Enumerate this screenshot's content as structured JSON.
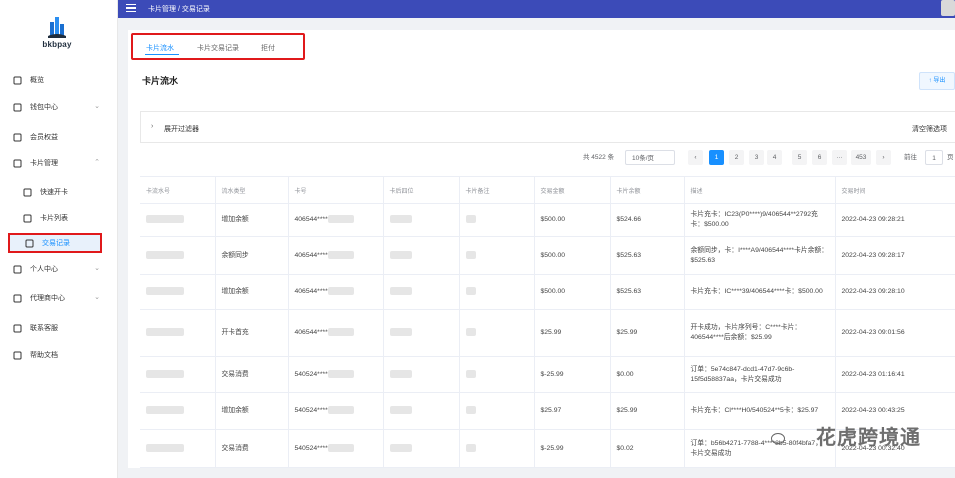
{
  "app": {
    "logo_text": "bkbpay"
  },
  "topbar": {
    "breadcrumb": "卡片管理 / 交易记录"
  },
  "sidebar": {
    "items": [
      {
        "label": "概览",
        "icon": "home-icon"
      },
      {
        "label": "钱包中心",
        "icon": "wallet-icon",
        "arrow": "⌄"
      },
      {
        "label": "会员权益",
        "icon": "member-icon"
      },
      {
        "label": "卡片管理",
        "icon": "card-icon",
        "arrow": "⌃"
      },
      {
        "label": "快速开卡",
        "icon": "file-icon"
      },
      {
        "label": "卡片列表",
        "icon": "list-icon"
      },
      {
        "label": "交易记录",
        "icon": "edit-icon"
      },
      {
        "label": "个人中心",
        "icon": "user-icon",
        "arrow": "⌄"
      },
      {
        "label": "代理商中心",
        "icon": "agent-icon",
        "arrow": "⌄"
      },
      {
        "label": "联系客服",
        "icon": "chat-icon"
      },
      {
        "label": "帮助文档",
        "icon": "doc-icon"
      }
    ]
  },
  "tabs": [
    "卡片流水",
    "卡片交易记录",
    "拒付"
  ],
  "page_title": "卡片流水",
  "export_label": "↑ 导出",
  "filter": {
    "toggle": "展开过滤器",
    "clear": "清空筛选项"
  },
  "pager": {
    "total": "共 4522 条",
    "page_size": "10条/页",
    "pages": [
      "1",
      "2",
      "3",
      "4",
      "5",
      "6",
      "···",
      "453"
    ],
    "goto_label": "前往",
    "goto_value": "1",
    "page_suffix": "页"
  },
  "table": {
    "headers": [
      "卡流水号",
      "流水类型",
      "卡号",
      "卡后四位",
      "卡片备注",
      "交易金额",
      "卡片余额",
      "描述",
      "交易时间"
    ],
    "rows": [
      {
        "type": "增加余额",
        "card": "406544****",
        "amount": "$500.00",
        "balance": "$524.66",
        "desc": "卡片充卡：IC23(P0****)9/406544**2792充卡：$500.00",
        "time": "2022-04-23 09:28:21"
      },
      {
        "type": "余额同步",
        "card": "406544****",
        "amount": "$500.00",
        "balance": "$525.63",
        "desc": "余额同步，卡：I****A9/406544****卡片余额：$525.63",
        "time": "2022-04-23 09:28:17"
      },
      {
        "type": "增加余额",
        "card": "406544****",
        "amount": "$500.00",
        "balance": "$525.63",
        "desc": "卡片充卡：IC****39/406544****卡：$500.00",
        "time": "2022-04-23 09:28:10"
      },
      {
        "type": "开卡首充",
        "card": "406544****",
        "amount": "$25.99",
        "balance": "$25.99",
        "desc": "开卡成功，卡片序列号：C****卡片：406544****后余额：$25.99",
        "time": "2022-04-23 09:01:56"
      },
      {
        "type": "交易消费",
        "card": "540524****",
        "amount": "$-25.99",
        "balance": "$0.00",
        "desc": "订单：5e74c847-dcd1-47d7-9c6b-15f5d58837aa，卡片交易成功",
        "time": "2022-04-23 01:16:41"
      },
      {
        "type": "增加余额",
        "card": "540524****",
        "amount": "$25.97",
        "balance": "$25.99",
        "desc": "卡片充卡：Cl****H0/540524**5卡：$25.97",
        "time": "2022-04-23 00:43:25"
      },
      {
        "type": "交易消费",
        "card": "540524****",
        "amount": "$-25.99",
        "balance": "$0.02",
        "desc": "订单：b56b4271-7788-4****8b5-80f4bfa7，卡片交易成功",
        "time": "2022-04-23 00:32:40"
      }
    ]
  },
  "watermark": "花虎跨境通",
  "colors": {
    "accent": "#1890ff",
    "topbar": "#3c4bb8",
    "highlight": "#e0191b"
  }
}
